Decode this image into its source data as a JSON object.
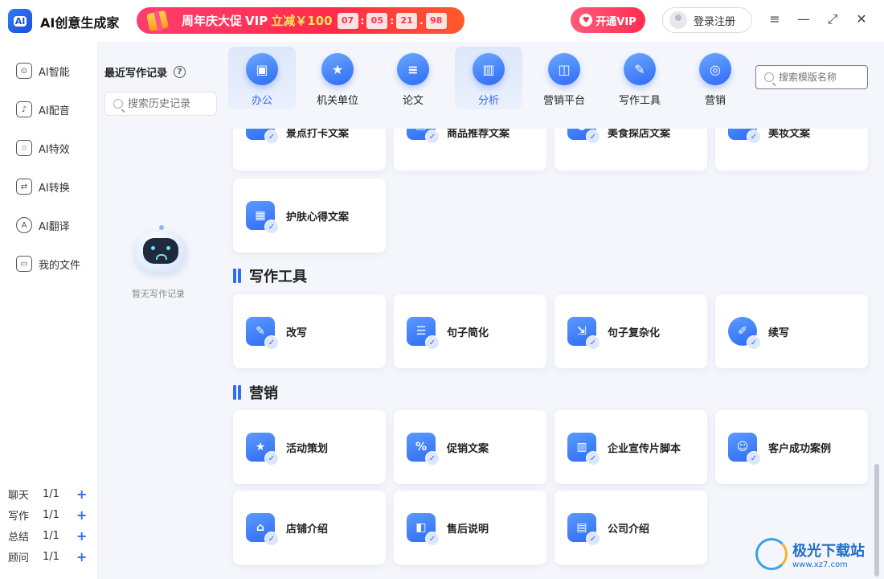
{
  "app": {
    "title": "AI创意生成家",
    "logo_text": "AI"
  },
  "promo": {
    "text": "周年庆大促",
    "vip": "VIP",
    "sub": "立减￥100",
    "countdown": [
      "07",
      "05",
      "21",
      "98"
    ]
  },
  "header": {
    "vip_button": "开通VIP",
    "login": "登录注册"
  },
  "window_controls": [
    "≡",
    "—",
    "⤢",
    "✕"
  ],
  "sidebar": {
    "items": [
      {
        "label": "AI智能",
        "icon": "robot-icon",
        "glyph": "⊙"
      },
      {
        "label": "AI配音",
        "icon": "microphone-icon",
        "glyph": "♪"
      },
      {
        "label": "AI特效",
        "icon": "star-icon",
        "glyph": "☆"
      },
      {
        "label": "AI转换",
        "icon": "convert-icon",
        "glyph": "⇄"
      },
      {
        "label": "AI翻译",
        "icon": "translate-icon",
        "glyph": "A"
      },
      {
        "label": "我的文件",
        "icon": "folder-icon",
        "glyph": "▭"
      }
    ],
    "quotas": [
      {
        "label": "聊天",
        "value": "1/1",
        "plus": "+"
      },
      {
        "label": "写作",
        "value": "1/1",
        "plus": "+"
      },
      {
        "label": "总结",
        "value": "1/1",
        "plus": "+"
      },
      {
        "label": "顾问",
        "value": "1/1",
        "plus": "+"
      }
    ]
  },
  "history": {
    "title": "最近写作记录",
    "help": "?",
    "search_placeholder": "搜索历史记录",
    "empty": "暂无写作记录"
  },
  "categories": {
    "tabs": [
      {
        "label": "办公",
        "glyph": "▣",
        "active": true
      },
      {
        "label": "机关单位",
        "glyph": "★",
        "active": false
      },
      {
        "label": "论文",
        "glyph": "≡",
        "active": false
      },
      {
        "label": "分析",
        "glyph": "▥",
        "active": true
      },
      {
        "label": "营销平台",
        "glyph": "◫",
        "active": false
      },
      {
        "label": "写作工具",
        "glyph": "✎",
        "active": false
      },
      {
        "label": "营销",
        "glyph": "◎",
        "active": false
      }
    ],
    "search_placeholder": "搜索模版名称"
  },
  "sections": {
    "top_cards": [
      {
        "label": "景点打卡文案",
        "glyph": "A"
      },
      {
        "label": "商品推荐文案",
        "glyph": "▤"
      },
      {
        "label": "美食探店文案",
        "glyph": "◒"
      },
      {
        "label": "美妆文案",
        "glyph": "♜"
      },
      {
        "label": "护肤心得文案",
        "glyph": "▦"
      }
    ],
    "writing_tools": {
      "title": "写作工具",
      "cards": [
        {
          "label": "改写",
          "glyph": "✎"
        },
        {
          "label": "句子简化",
          "glyph": "☰"
        },
        {
          "label": "句子复杂化",
          "glyph": "⇲"
        },
        {
          "label": "续写",
          "glyph": "✐"
        }
      ]
    },
    "marketing": {
      "title": "营销",
      "cards": [
        {
          "label": "活动策划",
          "glyph": "★"
        },
        {
          "label": "促销文案",
          "glyph": "%"
        },
        {
          "label": "企业宣传片脚本",
          "glyph": "▥"
        },
        {
          "label": "客户成功案例",
          "glyph": "☺"
        },
        {
          "label": "店铺介绍",
          "glyph": "⌂"
        },
        {
          "label": "售后说明",
          "glyph": "◧"
        },
        {
          "label": "公司介绍",
          "glyph": "▤"
        }
      ]
    }
  },
  "watermark": {
    "main": "极光下载站",
    "sub": "www.xz7.com"
  }
}
